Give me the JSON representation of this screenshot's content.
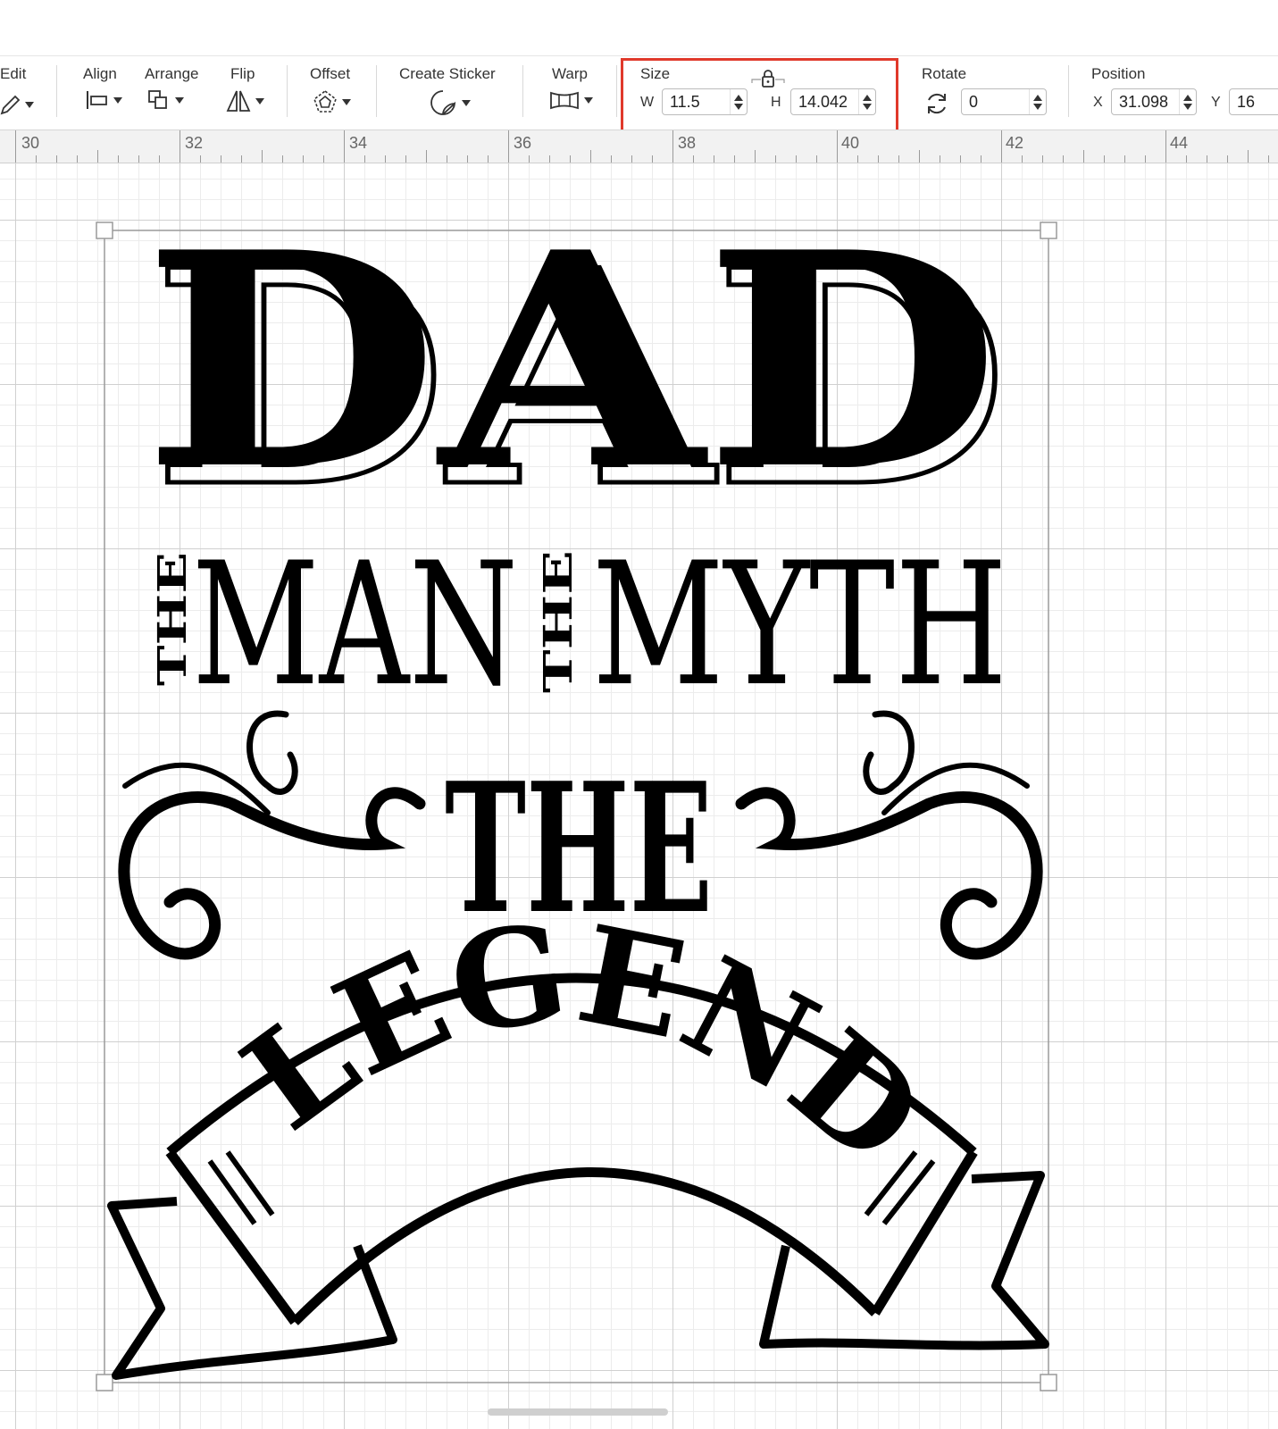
{
  "toolbar": {
    "edit_label": "Edit",
    "align_label": "Align",
    "arrange_label": "Arrange",
    "flip_label": "Flip",
    "offset_label": "Offset",
    "create_sticker_label": "Create Sticker",
    "warp_label": "Warp",
    "size": {
      "label": "Size",
      "w_label": "W",
      "w_value": "11.5",
      "h_label": "H",
      "h_value": "14.042",
      "lock_icon": "lock-icon"
    },
    "rotate": {
      "label": "Rotate",
      "value": "0"
    },
    "position": {
      "label": "Position",
      "x_label": "X",
      "x_value": "31.098",
      "y_label": "Y",
      "y_value": "16"
    }
  },
  "ruler": {
    "ticks": [
      "30",
      "32",
      "34",
      "36",
      "38",
      "40",
      "42",
      "44"
    ]
  },
  "design": {
    "line1": "DAD",
    "line2_small_a": "THE",
    "line2_word_a": "MAN",
    "line2_small_b": "THE",
    "line2_word_b": "MYTH",
    "line3": "THE",
    "line4": "LEGEND"
  },
  "colors": {
    "highlight": "#e0392b",
    "ink": "#000000",
    "grid": "#d0d0d0"
  }
}
